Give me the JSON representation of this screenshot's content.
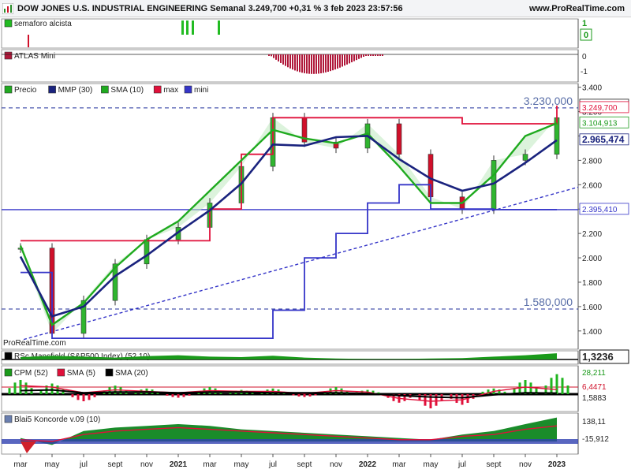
{
  "header": {
    "title": "DOW JONES U.S. INDUSTRIAL ENGINEERING Semanal 3.249,700 +0,31 % 3 feb 2023 23:57:56",
    "site": "www.ProRealTime.com",
    "watermark": "ProRealTime.com"
  },
  "panels": {
    "semaforo": {
      "label": "semaforo alcista",
      "right": [
        "1",
        "0"
      ],
      "color": "#22bb22"
    },
    "atlas": {
      "label": "ATLAS Mini",
      "right": [
        "0",
        "-1"
      ],
      "color": "#b0183a"
    },
    "price": {
      "legend": [
        {
          "label": "Precio",
          "color": "#22aa22"
        },
        {
          "label": "MMP (30)",
          "color": "#1a237e"
        },
        {
          "label": "SMA (10)",
          "color": "#1faa1f"
        },
        {
          "label": "max",
          "color": "#e0103a"
        },
        {
          "label": "mini",
          "color": "#3535c8"
        }
      ],
      "annotations": [
        "3.230,000",
        "1.580,000"
      ]
    },
    "rsc": {
      "label": "RSc Mansfield (S&P500 Index) (52 10)",
      "right": [
        "1,3236"
      ],
      "color": "#1a9a1a"
    },
    "cpm": {
      "legend": [
        {
          "label": "CPM (52)",
          "color": "#1a9a1a"
        },
        {
          "label": "SMA (5)",
          "color": "#e0103a"
        },
        {
          "label": "SMA (20)",
          "color": "#000000"
        }
      ],
      "right": [
        "28,211",
        "6,4471",
        "1,5883"
      ]
    },
    "koncorde": {
      "label": "Blai5 Koncorde v.09 (10)",
      "right": [
        "138,11",
        "-15,912"
      ]
    }
  },
  "chart_data": [
    {
      "type": "line",
      "title": "DOW JONES U.S. INDUSTRIAL ENGINEERING Semanal",
      "x": [
        "mar 2020",
        "may 2020",
        "jul 2020",
        "sept 2020",
        "nov 2020",
        "2021",
        "mar 2021",
        "may 2021",
        "jul 2021",
        "sept 2021",
        "nov 2021",
        "2022",
        "mar 2022",
        "may 2022",
        "jul 2022",
        "sept 2022",
        "nov 2022",
        "2023"
      ],
      "x_tick_labels": [
        "mar",
        "may",
        "jul",
        "sept",
        "nov",
        "2021",
        "mar",
        "may",
        "jul",
        "sept",
        "nov",
        "2022",
        "mar",
        "may",
        "jul",
        "sept",
        "nov",
        "2023"
      ],
      "y_tick_labels": [
        "3.400",
        "3.200",
        "3.000",
        "2.800",
        "2.600",
        "2.400",
        "2.200",
        "2.000",
        "1.800",
        "1.600",
        "1.400"
      ],
      "ylim": [
        1250,
        3430
      ],
      "series": [
        {
          "name": "Precio",
          "values": [
            2080,
            1380,
            1650,
            1950,
            2150,
            2250,
            2450,
            2750,
            3150,
            2950,
            2900,
            3100,
            2850,
            2500,
            2400,
            2800,
            2850,
            3150
          ]
        },
        {
          "name": "MMP (30)",
          "values": [
            2010,
            1520,
            1600,
            1850,
            2020,
            2210,
            2390,
            2610,
            2930,
            2920,
            2990,
            3000,
            2810,
            2650,
            2550,
            2610,
            2780,
            2965.474
          ]
        },
        {
          "name": "SMA (10)",
          "values": [
            2100,
            1450,
            1630,
            1920,
            2150,
            2300,
            2550,
            2800,
            3050,
            2980,
            2940,
            3020,
            2750,
            2450,
            2450,
            2680,
            3000,
            3104.913
          ]
        },
        {
          "name": "max",
          "values": [
            2140,
            2140,
            2140,
            2140,
            2140,
            2140,
            2400,
            2850,
            3150,
            3150,
            3150,
            3150,
            3150,
            3150,
            3100,
            3100,
            3100,
            3249.7
          ]
        },
        {
          "name": "mini",
          "values": [
            1880,
            1340,
            1340,
            1340,
            1340,
            1340,
            1340,
            1340,
            1570,
            2000,
            2200,
            2450,
            2600,
            2400,
            2400,
            2395.41,
            2395.41,
            2395.41
          ]
        }
      ],
      "reference_lines": [
        3230,
        1580,
        2395.41
      ],
      "right_labels": [
        {
          "text": "3.249,700",
          "value": 3249.7,
          "color": "#111111"
        },
        {
          "text": "3.249,700",
          "value": 3230,
          "color": "#e0103a"
        },
        {
          "text": "3.104,913",
          "value": 3104.913,
          "color": "#1a9a1a"
        },
        {
          "text": "2.965,474",
          "value": 2965.474,
          "color": "#1a237e"
        },
        {
          "text": "2.395,410",
          "value": 2395.41,
          "color": "#3535c8"
        }
      ]
    },
    {
      "type": "area",
      "title": "RSc Mansfield (S&P500 Index) (52 10)",
      "series": [
        {
          "name": "RSc Mansfield",
          "values": [
            0.5,
            0.8,
            0.6,
            0.4,
            0.7,
            0.9,
            0.6,
            0.5,
            0.8,
            0.4,
            0.2,
            0.1,
            0.1,
            0.2,
            0.3,
            0.6,
            0.9,
            1.3236
          ]
        }
      ]
    },
    {
      "type": "bar",
      "title": "CPM (52)",
      "series": [
        {
          "name": "CPM (52)",
          "values": [
            20,
            15,
            -10,
            12,
            8,
            -5,
            10,
            6,
            8,
            -4,
            10,
            6,
            -12,
            -20,
            -15,
            8,
            20,
            28.211
          ]
        },
        {
          "name": "SMA (5)",
          "values": [
            12,
            10,
            2,
            6,
            4,
            2,
            5,
            4,
            4,
            1,
            5,
            3,
            -6,
            -10,
            -8,
            4,
            10,
            6.4471
          ]
        },
        {
          "name": "SMA (20)",
          "values": [
            5,
            6,
            2,
            3,
            3,
            2,
            3,
            3,
            2,
            2,
            2,
            1,
            -2,
            -4,
            -5,
            -1,
            2,
            1.5883
          ]
        }
      ]
    },
    {
      "type": "area",
      "title": "Blai5 Koncorde v.09 (10)",
      "series": [
        {
          "name": "Koncorde",
          "values": [
            20,
            -20,
            60,
            80,
            90,
            100,
            90,
            70,
            60,
            50,
            40,
            30,
            20,
            10,
            40,
            60,
            100,
            138.11
          ]
        },
        {
          "name": "Media",
          "values": [
            10,
            0,
            40,
            60,
            70,
            80,
            70,
            60,
            50,
            40,
            30,
            20,
            10,
            10,
            30,
            40,
            70,
            90
          ]
        }
      ],
      "y_tick_labels": [
        "138,11",
        "-15,912"
      ]
    }
  ]
}
